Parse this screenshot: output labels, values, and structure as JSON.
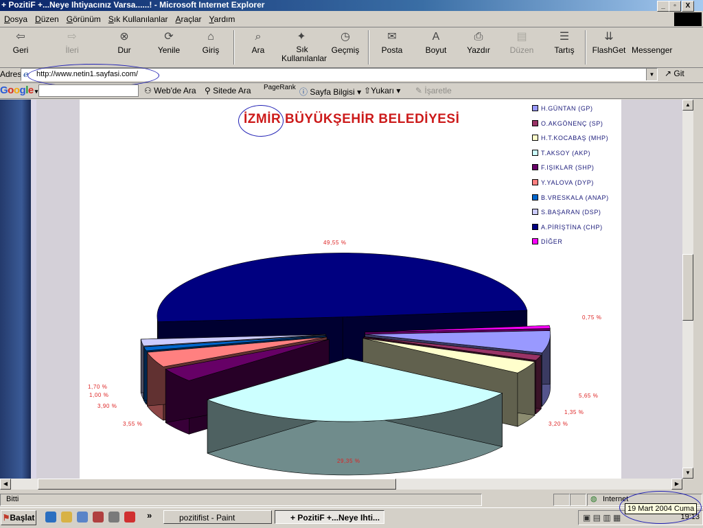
{
  "window": {
    "title": "+ PozitiF +...Neye Ihtiyacınız Varsa......! - Microsoft Internet Explorer",
    "controls": [
      "_",
      "▫",
      "X"
    ]
  },
  "menu": [
    "Dosya",
    "Düzen",
    "Görünüm",
    "Sık Kullanılanlar",
    "Araçlar",
    "Yardım"
  ],
  "toolbar": [
    {
      "label": "Geri",
      "icon": "back-arrow-icon",
      "glyph": "⇦",
      "enabled": true
    },
    {
      "label": "İleri",
      "icon": "forward-arrow-icon",
      "glyph": "⇨",
      "enabled": false
    },
    {
      "label": "Dur",
      "icon": "stop-icon",
      "glyph": "⊗",
      "enabled": true
    },
    {
      "label": "Yenile",
      "icon": "refresh-icon",
      "glyph": "⟳",
      "enabled": true
    },
    {
      "label": "Giriş",
      "icon": "home-icon",
      "glyph": "⌂",
      "enabled": true
    },
    {
      "label": "Ara",
      "icon": "search-icon",
      "glyph": "⌕",
      "enabled": true
    },
    {
      "label": "Sık Kullanılanlar",
      "icon": "favorites-icon",
      "glyph": "✦",
      "enabled": true
    },
    {
      "label": "Geçmiş",
      "icon": "history-icon",
      "glyph": "◷",
      "enabled": true
    },
    {
      "label": "Posta",
      "icon": "mail-icon",
      "glyph": "✉",
      "enabled": true
    },
    {
      "label": "Boyut",
      "icon": "font-size-icon",
      "glyph": "A",
      "enabled": true
    },
    {
      "label": "Yazdır",
      "icon": "print-icon",
      "glyph": "⎙",
      "enabled": true
    },
    {
      "label": "Düzen",
      "icon": "edit-icon",
      "glyph": "▤",
      "enabled": false
    },
    {
      "label": "Tartış",
      "icon": "discuss-icon",
      "glyph": "☰",
      "enabled": true
    },
    {
      "label": "FlashGet",
      "icon": "flashget-icon",
      "glyph": "⇊",
      "enabled": true
    },
    {
      "label": "Messenger",
      "icon": "messenger-icon",
      "glyph": "",
      "enabled": true
    }
  ],
  "address": {
    "label": "Adres",
    "url": "http://www.netin1.sayfasi.com/",
    "go_label": "Git"
  },
  "googlebar": {
    "logo": "Google",
    "items": [
      "Web'de Ara",
      "Sitede Ara",
      "PageRank",
      "Sayfa Bilgisi",
      "Yukarı",
      "İşaretle"
    ]
  },
  "chart_data": {
    "type": "pie",
    "title": "İZMİR BÜYÜKŞEHİR BELEDİYESİ",
    "legend_position": "top-right",
    "legend": [
      {
        "name": "H.GÜNTAN (GP)",
        "color": "#9999ff"
      },
      {
        "name": "O.AKGÖNENÇ (SP)",
        "color": "#993366"
      },
      {
        "name": "H.T.KOCABAŞ (MHP)",
        "color": "#ffffcc"
      },
      {
        "name": "T.AKSOY (AKP)",
        "color": "#ccffff"
      },
      {
        "name": "F.IŞIKLAR (SHP)",
        "color": "#660066"
      },
      {
        "name": "Y.YALOVA (DYP)",
        "color": "#ff8080"
      },
      {
        "name": "B.VRESKALA (ANAP)",
        "color": "#0066cc"
      },
      {
        "name": "S.BAŞARAN (DSP)",
        "color": "#ccccff"
      },
      {
        "name": "A.PİRİŞTİNA (CHP)",
        "color": "#000080"
      },
      {
        "name": "DİĞER",
        "color": "#ff00ff"
      }
    ],
    "slices": [
      {
        "label": "DİĞER",
        "value": 0.75,
        "text": "0,75 %",
        "color": "#ff00ff"
      },
      {
        "label": "H.GÜNTAN (GP)",
        "value": 5.65,
        "text": "5,65 %",
        "color": "#9999ff"
      },
      {
        "label": "O.AKGÖNENÇ (SP)",
        "value": 1.35,
        "text": "1,35 %",
        "color": "#993366"
      },
      {
        "label": "H.T.KOCABAŞ (MHP)",
        "value": 3.2,
        "text": "3,20 %",
        "color": "#ffffcc"
      },
      {
        "label": "T.AKSOY (AKP)",
        "value": 29.35,
        "text": "29,35 %",
        "color": "#ccffff"
      },
      {
        "label": "F.IŞIKLAR (SHP)",
        "value": 3.55,
        "text": "3,55 %",
        "color": "#660066"
      },
      {
        "label": "Y.YALOVA (DYP)",
        "value": 3.9,
        "text": "3,90 %",
        "color": "#ff8080"
      },
      {
        "label": "B.VRESKALA (ANAP)",
        "value": 1.0,
        "text": "1,00 %",
        "color": "#0066cc"
      },
      {
        "label": "S.BAŞARAN (DSP)",
        "value": 1.7,
        "text": "1,70 %",
        "color": "#ccccff"
      },
      {
        "label": "A.PİRİŞTİNA (CHP)",
        "value": 49.55,
        "text": "49,55 %",
        "color": "#000080"
      }
    ]
  },
  "status": {
    "text": "Bitti",
    "zone": "Internet"
  },
  "taskbar": {
    "start_label": "Başlat",
    "tasks": [
      {
        "label": "pozitifist - Paint",
        "active": false
      },
      {
        "label": "+ PozitiF +...Neye Ihti...",
        "active": true
      }
    ],
    "clock": "19:13",
    "tooltip": "19 Mart 2004 Cuma",
    "chevron": "»"
  }
}
